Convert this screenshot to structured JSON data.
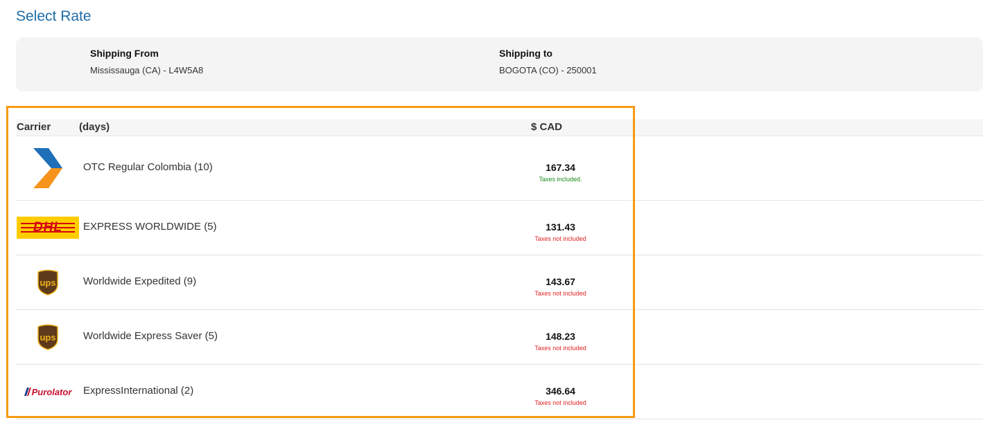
{
  "page_title": "Select Rate",
  "shipping": {
    "from_label": "Shipping From",
    "from_value": "Mississauga (CA) - L4W5A8",
    "to_label": "Shipping to",
    "to_value": "BOGOTA (CO) - 250001"
  },
  "table": {
    "headers": {
      "carrier": "Carrier",
      "days": "(days)",
      "price": "$ CAD"
    },
    "rows": [
      {
        "carrier_logo": "chevron-carrier-logo",
        "service": "OTC Regular Colombia (10)",
        "price": "167.34",
        "tax_note": "Taxes included.",
        "tax_included": true
      },
      {
        "carrier_logo": "dhl-logo",
        "logo_text": "DHL",
        "service": "EXPRESS WORLDWIDE (5)",
        "price": "131.43",
        "tax_note": "Taxes not included",
        "tax_included": false
      },
      {
        "carrier_logo": "ups-logo",
        "logo_text": "ups",
        "service": "Worldwide Expedited (9)",
        "price": "143.67",
        "tax_note": "Taxes not included",
        "tax_included": false
      },
      {
        "carrier_logo": "ups-logo",
        "logo_text": "ups",
        "service": "Worldwide Express Saver (5)",
        "price": "148.23",
        "tax_note": "Taxes not included",
        "tax_included": false
      },
      {
        "carrier_logo": "purolator-logo",
        "logo_text": "Purolator",
        "service": "ExpressInternational (2)",
        "price": "346.64",
        "tax_note": "Taxes not included",
        "tax_included": false
      }
    ]
  },
  "colors": {
    "title": "#1f6da8",
    "highlight": "#f59a12",
    "tax_included": "#1a8a1a",
    "tax_excluded": "#e0201f",
    "dhl_yellow": "#ffcc00",
    "dhl_red": "#d40511",
    "ups_brown": "#5c3a1a",
    "ups_gold": "#f2b21b",
    "purolator_red": "#c8102e",
    "purolator_blue": "#1b3b8c"
  }
}
